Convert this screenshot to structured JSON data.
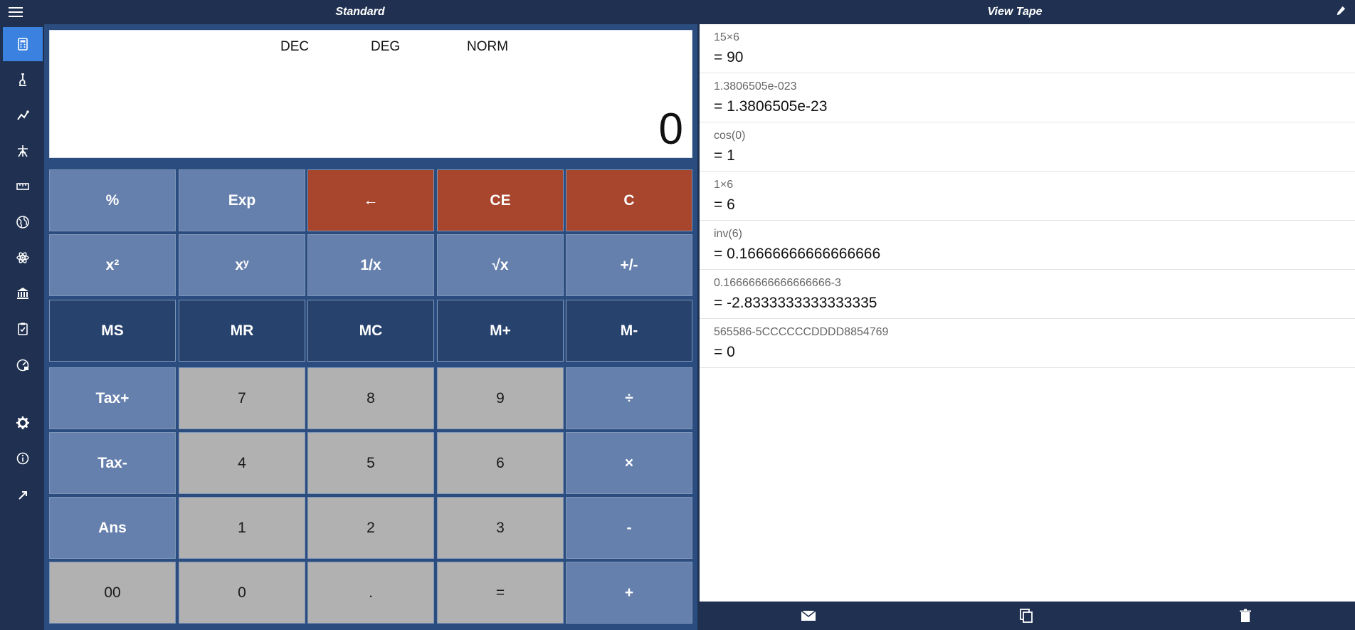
{
  "titlebar": {
    "left_title": "Standard",
    "right_title": "View Tape"
  },
  "sidebar": {
    "items": [
      {
        "name": "calculator-icon",
        "active": true
      },
      {
        "name": "scientific-icon"
      },
      {
        "name": "graph-icon"
      },
      {
        "name": "network-icon"
      },
      {
        "name": "ruler-icon"
      },
      {
        "name": "globe-icon"
      },
      {
        "name": "atom-icon"
      },
      {
        "name": "bank-icon"
      },
      {
        "name": "clipboard-icon"
      },
      {
        "name": "dashboard-icon"
      },
      {
        "name": "settings-icon"
      },
      {
        "name": "info-icon"
      },
      {
        "name": "expand-icon"
      }
    ]
  },
  "display": {
    "base": "DEC",
    "angle": "DEG",
    "notation": "NORM",
    "value": "0"
  },
  "keys": {
    "row1": [
      "%",
      "Exp",
      "←",
      "CE",
      "C"
    ],
    "row2": [
      "x²",
      "xʸ",
      "1/x",
      "√x",
      "+/-"
    ],
    "row3": [
      "MS",
      "MR",
      "MC",
      "M+",
      "M-"
    ],
    "row4": [
      "Tax+",
      "7",
      "8",
      "9",
      "÷"
    ],
    "row5": [
      "Tax-",
      "4",
      "5",
      "6",
      "×"
    ],
    "row6": [
      "Ans",
      "1",
      "2",
      "3",
      "-"
    ],
    "row7": [
      "00",
      "0",
      ".",
      "=",
      "+"
    ]
  },
  "tape": {
    "entries": [
      {
        "expr": "15×6",
        "result": "= 90"
      },
      {
        "expr": "1.3806505e-023",
        "result": "= 1.3806505e-23"
      },
      {
        "expr": "cos(0)",
        "result": "= 1"
      },
      {
        "expr": "1×6",
        "result": "= 6"
      },
      {
        "expr": "inv(6)",
        "result": "= 0.16666666666666666"
      },
      {
        "expr": "0.16666666666666666-3",
        "result": "= -2.8333333333333335"
      },
      {
        "expr": "565586-5CCCCCCDDDD8854769",
        "result": "= 0"
      }
    ]
  },
  "footer": {
    "icons": [
      "mail-icon",
      "copy-icon",
      "delete-icon"
    ]
  },
  "colors": {
    "background": "#1f3050",
    "accent": "#3b82e0",
    "function_key": "#6680ad",
    "memory_key": "#26426d",
    "danger_key": "#a7452d",
    "number_key": "#b1b1b1"
  }
}
